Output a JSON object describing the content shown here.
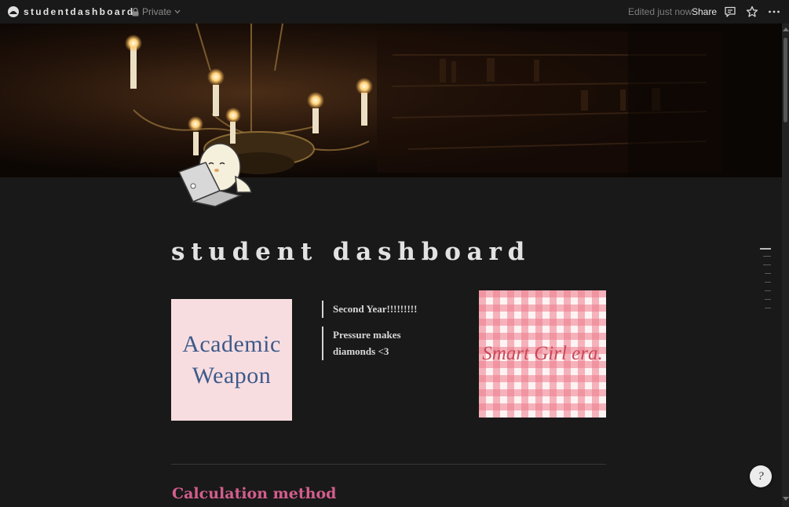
{
  "topbar": {
    "workspace_title": "studentdashboard",
    "privacy_label": "Private",
    "edited_label": "Edited just now",
    "share_label": "Share"
  },
  "page": {
    "title": "student dashboard"
  },
  "cards": {
    "academic_line1": "Academic",
    "academic_line2": "Weapon",
    "gingham_text": "Smart Girl era."
  },
  "quotes": {
    "q1": "Second Year!!!!!!!!!",
    "q2_line1": "Pressure makes",
    "q2_line2": "diamonds <3"
  },
  "sections": {
    "heading1": "Calculation method"
  },
  "help": {
    "glyph": "?"
  },
  "icons": [
    "workspace-icon",
    "lock-icon",
    "chevron-down-icon",
    "comment-icon",
    "star-icon",
    "more-icon",
    "help-icon"
  ],
  "colors": {
    "background": "#191919",
    "heading_accent": "#d35e8d",
    "academic_card_bg": "#f8dde0",
    "academic_text": "#3c5a8a",
    "gingham_pink": "#ef7c8c"
  }
}
